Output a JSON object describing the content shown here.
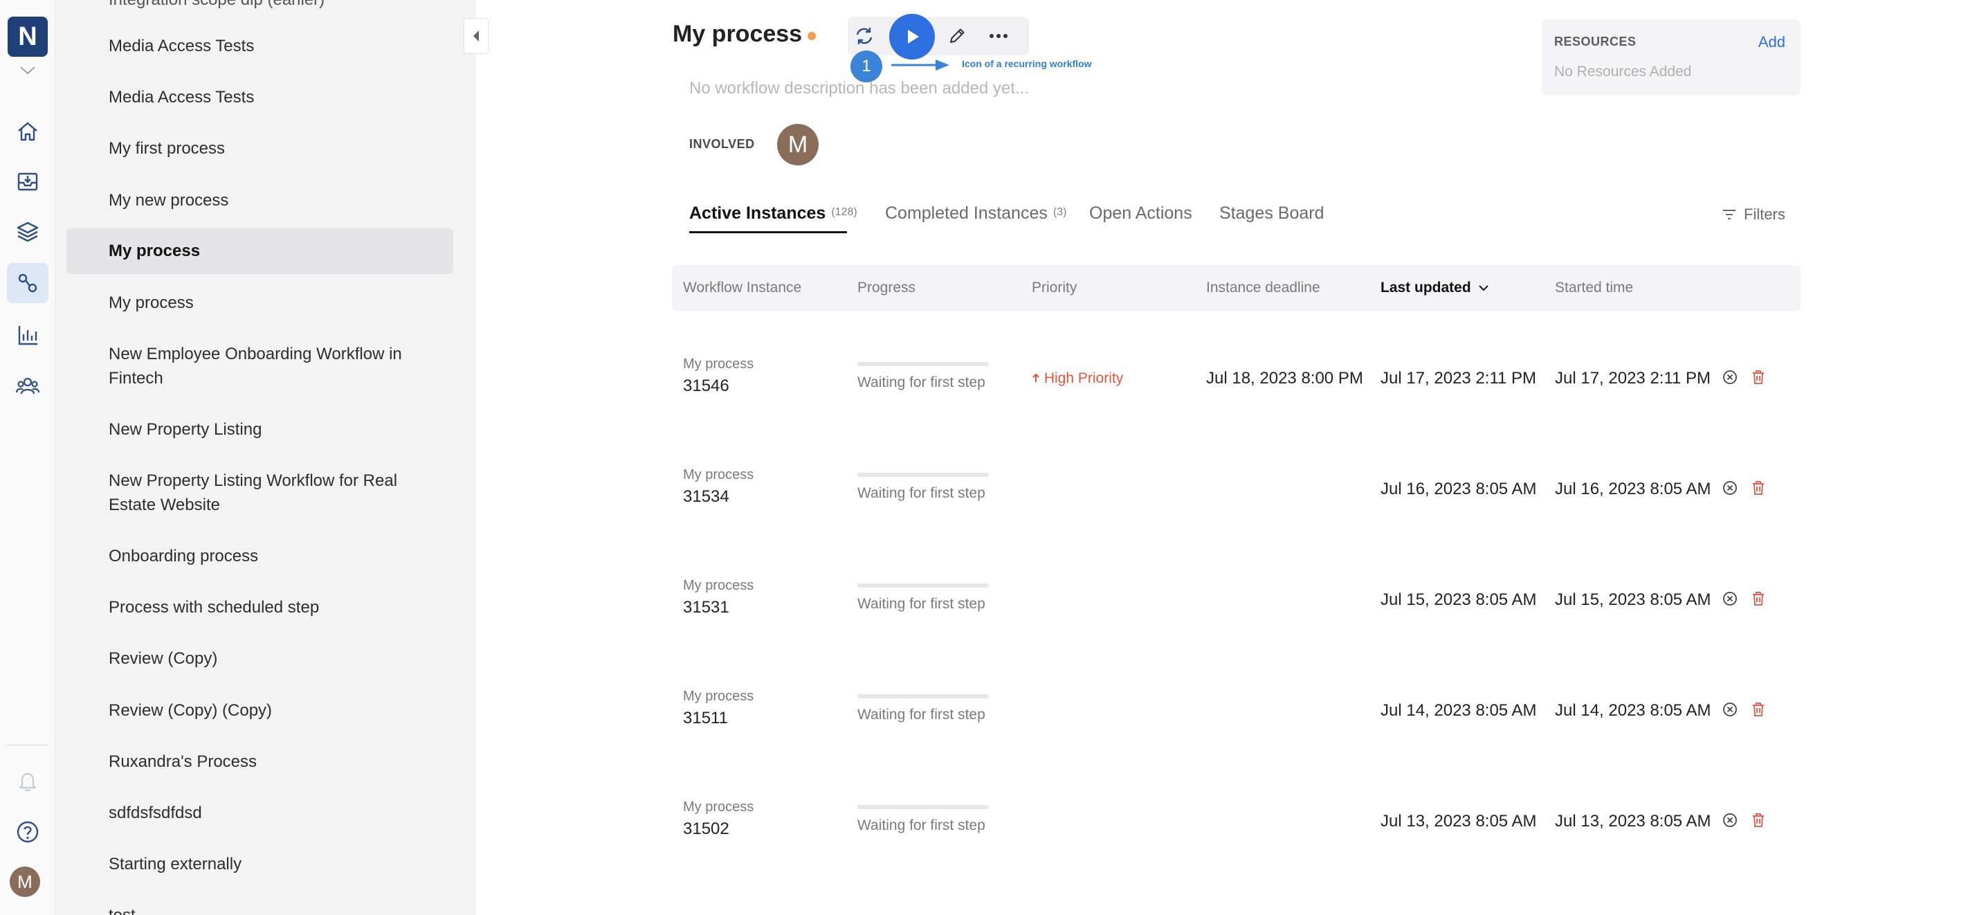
{
  "rail": {
    "logo": "N",
    "avatar": "M"
  },
  "process_list": [
    {
      "label": "Integration scope dip (earlier)"
    },
    {
      "label": "Media Access Tests"
    },
    {
      "label": "Media Access Tests"
    },
    {
      "label": "My first process"
    },
    {
      "label": "My new process"
    },
    {
      "label": "My process",
      "selected": true
    },
    {
      "label": "My process"
    },
    {
      "label": "New Employee Onboarding Workflow in Fintech"
    },
    {
      "label": "New Property Listing"
    },
    {
      "label": "New Property Listing Workflow for Real Estate Website"
    },
    {
      "label": "Onboarding process"
    },
    {
      "label": "Process with scheduled step"
    },
    {
      "label": "Review (Copy)"
    },
    {
      "label": "Review (Copy) (Copy)"
    },
    {
      "label": "Ruxandra's Process"
    },
    {
      "label": "sdfdsfsdfdsd"
    },
    {
      "label": "Starting externally"
    },
    {
      "label": "test"
    }
  ],
  "header": {
    "title": "My process",
    "description_placeholder": "No workflow description has been added yet...",
    "involved_label": "INVOLVED",
    "involved_avatar": "M",
    "callout_number": "1",
    "callout_text": "Icon of a recurring workflow"
  },
  "resources": {
    "title": "RESOURCES",
    "add_label": "Add",
    "empty_text": "No Resources Added"
  },
  "tabs": [
    {
      "label": "Active Instances",
      "count": "(128)",
      "active": true
    },
    {
      "label": "Completed Instances",
      "count": "(3)"
    },
    {
      "label": "Open Actions",
      "count": ""
    },
    {
      "label": "Stages Board",
      "count": ""
    }
  ],
  "filters_label": "Filters",
  "table": {
    "columns": [
      "Workflow Instance",
      "Progress",
      "Priority",
      "Instance deadline",
      "Last updated",
      "Started time"
    ],
    "sorted_column": "Last updated",
    "rows": [
      {
        "workflow": "My process",
        "id": "31546",
        "progress_text": "Waiting for first step",
        "progress": 0,
        "priority": "High Priority",
        "deadline": "Jul 18, 2023 8:00 PM",
        "last_updated": "Jul 17, 2023 2:11 PM",
        "started": "Jul 17, 2023 2:11 PM"
      },
      {
        "workflow": "My process",
        "id": "31534",
        "progress_text": "Waiting for first step",
        "progress": 0,
        "priority": "",
        "deadline": "",
        "last_updated": "Jul 16, 2023 8:05 AM",
        "started": "Jul 16, 2023 8:05 AM"
      },
      {
        "workflow": "My process",
        "id": "31531",
        "progress_text": "Waiting for first step",
        "progress": 0,
        "priority": "",
        "deadline": "",
        "last_updated": "Jul 15, 2023 8:05 AM",
        "started": "Jul 15, 2023 8:05 AM"
      },
      {
        "workflow": "My process",
        "id": "31511",
        "progress_text": "Waiting for first step",
        "progress": 0,
        "priority": "",
        "deadline": "",
        "last_updated": "Jul 14, 2023 8:05 AM",
        "started": "Jul 14, 2023 8:05 AM"
      },
      {
        "workflow": "My process",
        "id": "31502",
        "progress_text": "Waiting for first step",
        "progress": 0,
        "priority": "",
        "deadline": "",
        "last_updated": "Jul 13, 2023 8:05 AM",
        "started": "Jul 13, 2023 8:05 AM"
      }
    ]
  },
  "colors": {
    "accent": "#2e6fe0",
    "logo_bg": "#1f3f78",
    "priority_high": "#e5533d",
    "status_dot": "#f4a04a",
    "callout": "#3a85d8"
  }
}
